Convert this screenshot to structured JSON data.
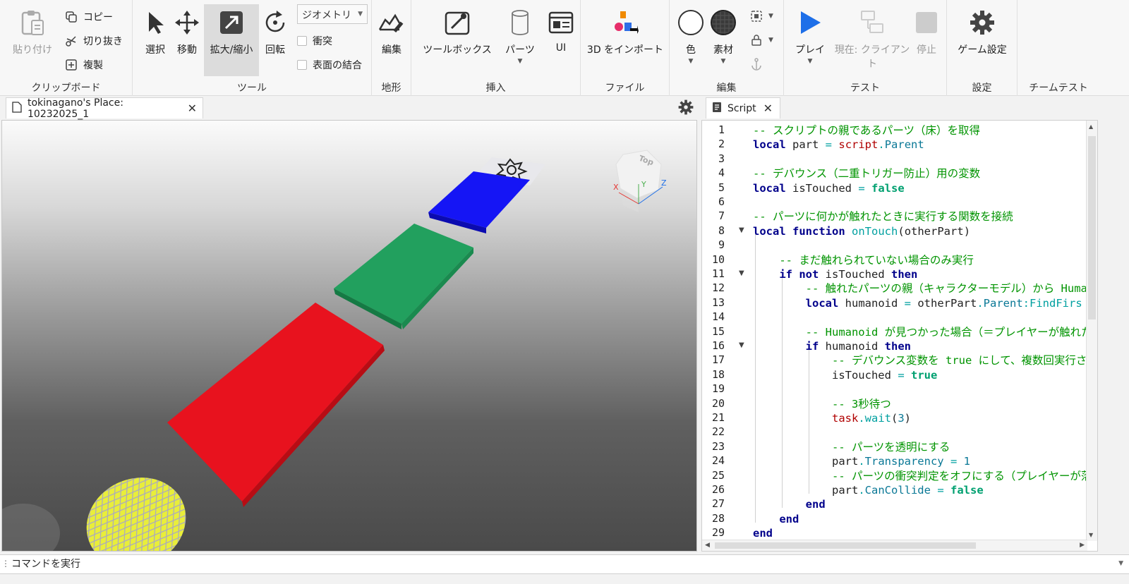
{
  "ribbon": {
    "clipboard": {
      "label": "クリップボード",
      "paste": "貼り付け",
      "copy": "コピー",
      "cut": "切り抜き",
      "duplicate": "複製"
    },
    "tools": {
      "label": "ツール",
      "select": "選択",
      "move": "移動",
      "scale": "拡大/縮小",
      "rotate": "回転",
      "mode_dropdown": "ジオメトリ",
      "collisions": "衝突",
      "join_surfaces": "表面の結合"
    },
    "terrain": {
      "label": "地形",
      "editor": "編集"
    },
    "insert": {
      "label": "挿入",
      "toolbox": "ツールボックス",
      "part": "パーツ",
      "ui": "UI"
    },
    "file": {
      "label": "ファイル",
      "import3d": "3D をインポート"
    },
    "edit": {
      "label": "編集",
      "color": "色",
      "material": "素材"
    },
    "test": {
      "label": "テスト",
      "play": "プレイ",
      "current_line1": "現在: クライアン",
      "current_line2": "ト",
      "stop": "停止"
    },
    "settings": {
      "label": "設定",
      "game_settings": "ゲーム設定"
    },
    "team_test": {
      "label": "チームテスト"
    }
  },
  "tabs": {
    "place": "tokinagano's Place: 10232025_1",
    "script": "Script"
  },
  "viewcube": {
    "top": "Top",
    "x": "X",
    "y": "Y",
    "z": "Z"
  },
  "colors": {
    "blue_part": "#1515f5",
    "green_part": "#22a05e",
    "red_part": "#e8121e",
    "yellow_part": "#e9ee3a",
    "comment": "#009400",
    "keyword": "#00008b",
    "play_icon": "#1e6fe8"
  },
  "editor": {
    "line_numbers": [
      "1",
      "2",
      "3",
      "4",
      "5",
      "6",
      "7",
      "8",
      "9",
      "10",
      "11",
      "12",
      "13",
      "14",
      "15",
      "16",
      "17",
      "18",
      "19",
      "20",
      "21",
      "22",
      "23",
      "24",
      "25",
      "26",
      "27",
      "28",
      "29"
    ],
    "lines": [
      "-- スクリプトの親であるパーツ（床）を取得",
      "local part = script.Parent",
      "",
      "-- デバウンス（二重トリガー防止）用の変数",
      "local isTouched = false",
      "",
      "-- パーツに何かが触れたときに実行する関数を接続",
      "local function onTouch(otherPart)",
      "",
      "    -- まだ触れられていない場合のみ実行",
      "    if not isTouched then",
      "        -- 触れたパーツの親（キャラクターモデル）から Humanoid を",
      "        local humanoid = otherPart.Parent:FindFirs",
      "",
      "        -- Humanoid が見つかった場合（＝プレイヤーが触れた場合",
      "        if humanoid then",
      "            -- デバウンス変数を true にして、複数回実行されるの",
      "            isTouched = true",
      "",
      "            -- 3秒待つ",
      "            task.wait(3)",
      "",
      "            -- パーツを透明にする",
      "            part.Transparency = 1",
      "            -- パーツの衝突判定をオフにする（プレイヤーが落ちるよう",
      "            part.CanCollide = false",
      "        end",
      "    end",
      "end"
    ]
  },
  "command_bar": {
    "placeholder": "コマンドを実行"
  }
}
